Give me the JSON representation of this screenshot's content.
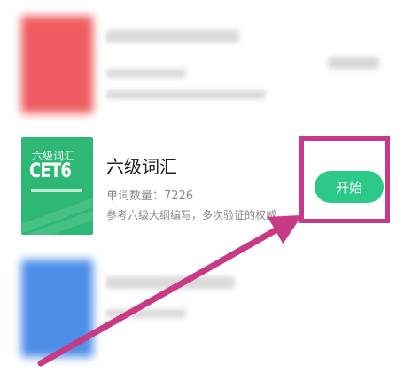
{
  "books": [
    {
      "name": "blurred-book-1",
      "cover_color": "#ee5c5f"
    },
    {
      "name": "cet6",
      "cover_color": "#2eb875",
      "cover_top": "六级词汇",
      "cover_big": "CET6",
      "title": "六级词汇",
      "count": "单词数量：7226",
      "description": "参考六级大纲编写，多次验证的权威...",
      "button": "开始"
    },
    {
      "name": "blurred-book-3",
      "cover_color": "#4d8ee8"
    }
  ],
  "annotation": {
    "highlight_color": "#c93a86",
    "arrow_color": "#c93a86"
  }
}
